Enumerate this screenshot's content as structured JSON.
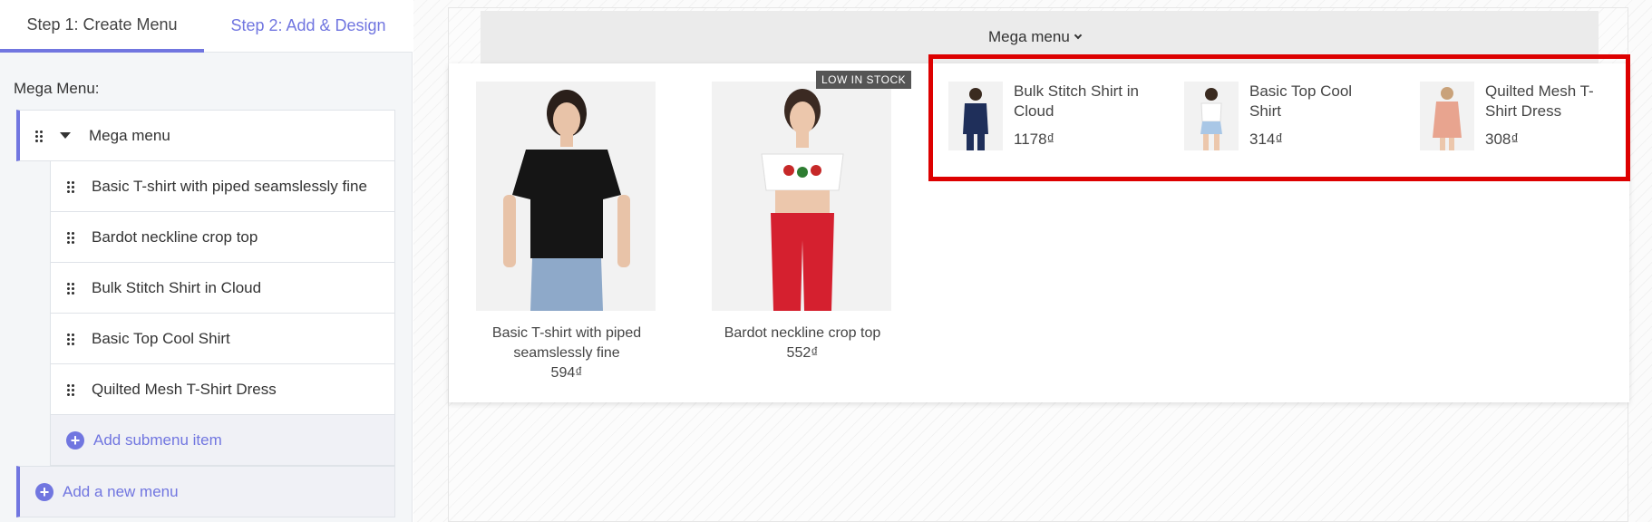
{
  "tabs": [
    {
      "label": "Step 1: Create Menu",
      "active": true
    },
    {
      "label": "Step 2: Add & Design",
      "active": false
    }
  ],
  "editor": {
    "title": "Mega Menu:",
    "top_item": "Mega menu",
    "sub_items": [
      "Basic T-shirt with piped seamslessly fine",
      "Bardot neckline crop top",
      "Bulk Stitch Shirt in Cloud",
      "Basic Top Cool Shirt",
      "Quilted Mesh T-Shirt Dress"
    ],
    "add_submenu": "Add submenu item",
    "add_menu": "Add a new menu"
  },
  "preview": {
    "nav_label": "Mega menu",
    "badge": "LOW IN STOCK",
    "large_products": [
      {
        "name": "Basic T-shirt with piped seamslessly fine",
        "price": "594₫"
      },
      {
        "name": "Bardot neckline crop top",
        "price": "552₫"
      }
    ],
    "small_products": [
      {
        "name": "Bulk Stitch Shirt in Cloud",
        "price": "1178₫"
      },
      {
        "name": "Basic Top Cool Shirt",
        "price": "314₫"
      },
      {
        "name": "Quilted Mesh T-Shirt Dress",
        "price": "308₫"
      }
    ]
  },
  "colors": {
    "accent": "#7176e0",
    "highlight": "#dd0000"
  }
}
